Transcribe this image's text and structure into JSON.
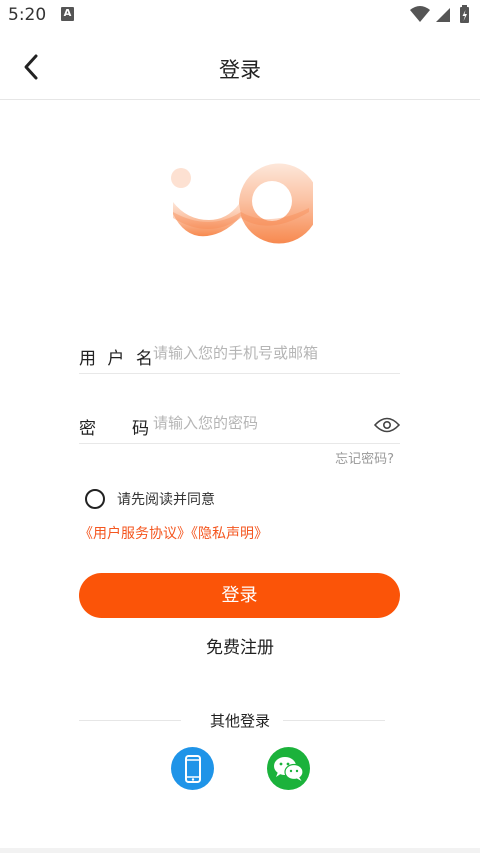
{
  "status_bar": {
    "time": "5:20",
    "notification_icon": "A",
    "icons": [
      "wifi-icon",
      "signal-icon",
      "battery-charging-icon"
    ]
  },
  "app_bar": {
    "title": "登录",
    "back_icon": "chevron-left-icon"
  },
  "form": {
    "username": {
      "label_chars": [
        "用",
        "户",
        "名"
      ],
      "placeholder": "请输入您的手机号或邮箱",
      "value": ""
    },
    "password": {
      "label_chars": [
        "密",
        "码"
      ],
      "placeholder": "请输入您的密码",
      "value": "",
      "toggle_icon": "eye-icon"
    },
    "forgot_password": "忘记密码?"
  },
  "agreement": {
    "checked": false,
    "text": "请先阅读并同意",
    "service_agreement": "《用户服务协议》",
    "privacy_statement": "《隐私声明》"
  },
  "actions": {
    "login_label": "登录",
    "register_label": "免费注册"
  },
  "other_login": {
    "title": "其他登录",
    "options": [
      {
        "icon": "phone-icon",
        "color": "#1f94e8"
      },
      {
        "icon": "wechat-icon",
        "color": "#1bb23b"
      }
    ]
  },
  "colors": {
    "accent": "#fb5408",
    "link": "#f4561f",
    "logo_gradient": [
      "#fde0d0",
      "#f79666"
    ]
  }
}
